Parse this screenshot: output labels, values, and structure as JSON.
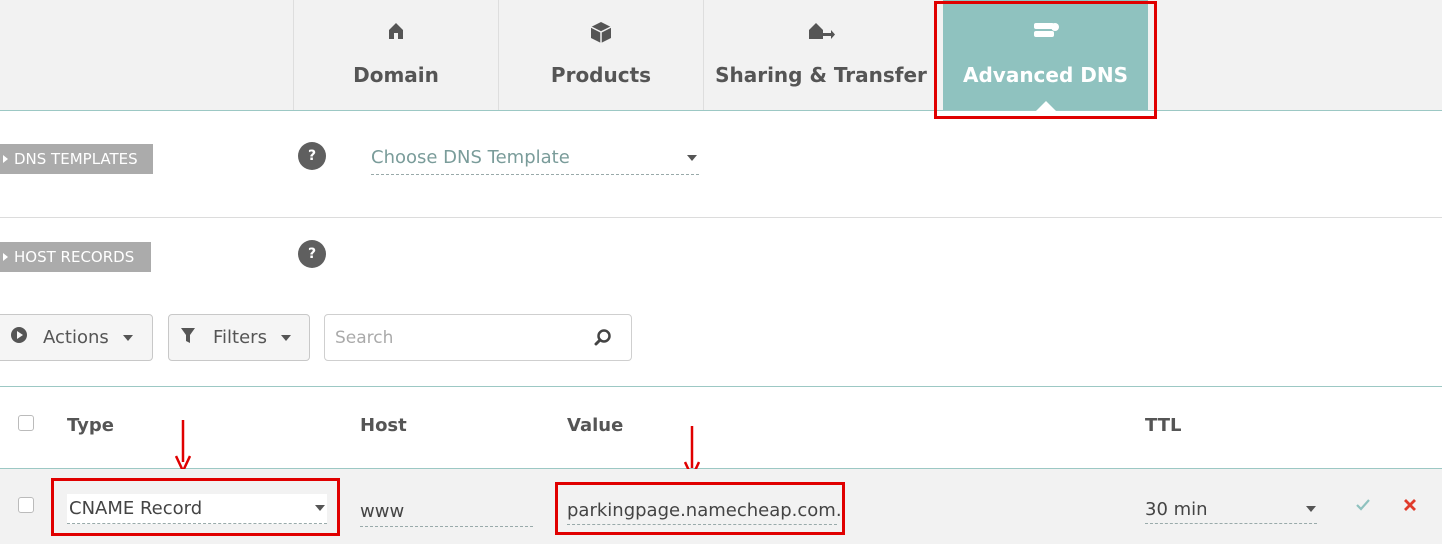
{
  "tabs": [
    {
      "label": "Domain",
      "icon": "home-icon",
      "active": false
    },
    {
      "label": "Products",
      "icon": "box-icon",
      "active": false
    },
    {
      "label": "Sharing & Transfer",
      "icon": "transfer-icon",
      "active": false
    },
    {
      "label": "Advanced DNS",
      "icon": "server-icon",
      "active": true
    }
  ],
  "dns_templates": {
    "label": "DNS TEMPLATES",
    "help": "?",
    "select_value": "Choose DNS Template"
  },
  "host_records": {
    "label": "HOST RECORDS",
    "help": "?"
  },
  "toolbar": {
    "actions_label": "Actions",
    "filters_label": "Filters",
    "search_placeholder": "Search"
  },
  "table": {
    "columns": [
      "Type",
      "Host",
      "Value",
      "TTL"
    ],
    "rows": [
      {
        "type": "CNAME Record",
        "host": "www",
        "value": "parkingpage.namecheap.com.",
        "ttl": "30 min"
      }
    ]
  },
  "colors": {
    "accent": "#8fc2bf",
    "highlight": "#e00000",
    "confirm": "#8fc2bf",
    "delete": "#e03b2b"
  }
}
